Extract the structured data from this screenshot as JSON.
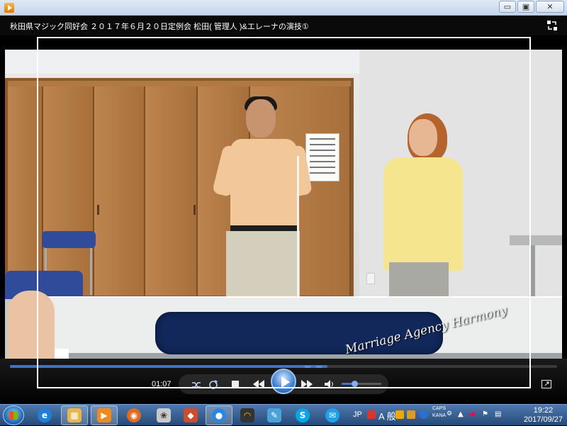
{
  "window": {
    "title": "秋田県マジック同好会 ２０１７年６月２０日定例会 松田( 管理人 )&エレーナの演技①",
    "minimize_glyph": "▭",
    "maximize_glyph": "▣",
    "close_glyph": "✕"
  },
  "video": {
    "watermark": "Marriage Agency Harmony"
  },
  "controls": {
    "time": "01:07",
    "seek_progress": 0.58,
    "volume_level": 0.35
  },
  "taskbar": {
    "items": [
      {
        "name": "internet-explorer",
        "glyph": "e"
      },
      {
        "name": "file-explorer",
        "glyph": "▦"
      },
      {
        "name": "media-player",
        "glyph": "▶"
      },
      {
        "name": "firefox",
        "glyph": "◉"
      },
      {
        "name": "app-cat",
        "glyph": "❀"
      },
      {
        "name": "app-paint-bucket",
        "glyph": "◆"
      },
      {
        "name": "app-blue-circle",
        "glyph": "●"
      },
      {
        "name": "app-headphones",
        "glyph": "◠"
      },
      {
        "name": "app-paint",
        "glyph": "✎"
      },
      {
        "name": "skype",
        "glyph": "S"
      },
      {
        "name": "app-chat",
        "glyph": "✉"
      }
    ],
    "lang": "JP",
    "ime": "A 般",
    "caps": "CAPS",
    "kana": "KANA",
    "clock_time": "19:22",
    "clock_date": "2017/09/27"
  },
  "colors": {
    "accent": "#3c74c2",
    "taskbar": "#274a78"
  }
}
